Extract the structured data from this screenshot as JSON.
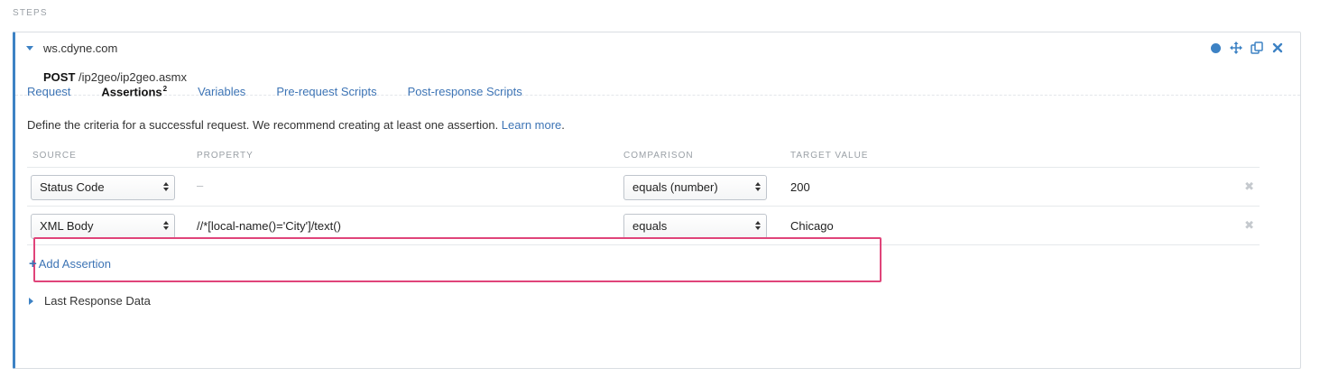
{
  "section": {
    "label": "STEPS"
  },
  "step": {
    "host": "ws.cdyne.com",
    "method": "POST",
    "path": "/ip2geo/ip2geo.asmx",
    "actions": [
      "status-dot-icon",
      "move-icon",
      "duplicate-icon",
      "close-icon"
    ]
  },
  "tabs": [
    {
      "label": "Request",
      "active": false
    },
    {
      "label": "Assertions",
      "badge": "2",
      "active": true
    },
    {
      "label": "Variables",
      "active": false
    },
    {
      "label": "Pre-request Scripts",
      "active": false
    },
    {
      "label": "Post-response Scripts",
      "active": false
    }
  ],
  "help": {
    "text": "Define the criteria for a successful request. We recommend creating at least one assertion. ",
    "link": "Learn more",
    "suffix": "."
  },
  "table": {
    "headers": {
      "source": "SOURCE",
      "property": "PROPERTY",
      "comparison": "COMPARISON",
      "target": "TARGET VALUE"
    },
    "rows": [
      {
        "source": "Status Code",
        "property": "",
        "property_placeholder": "–",
        "comparison": "equals (number)",
        "target": "200"
      },
      {
        "source": "XML Body",
        "property": "//*[local-name()='City']/text()",
        "comparison": "equals",
        "target": "Chicago"
      }
    ]
  },
  "add_assertion": {
    "label": "Add Assertion"
  },
  "last_response": {
    "label": "Last Response Data"
  },
  "colors": {
    "accent": "#3d82c4",
    "link": "#3d74b5",
    "highlight": "#e0447a"
  }
}
